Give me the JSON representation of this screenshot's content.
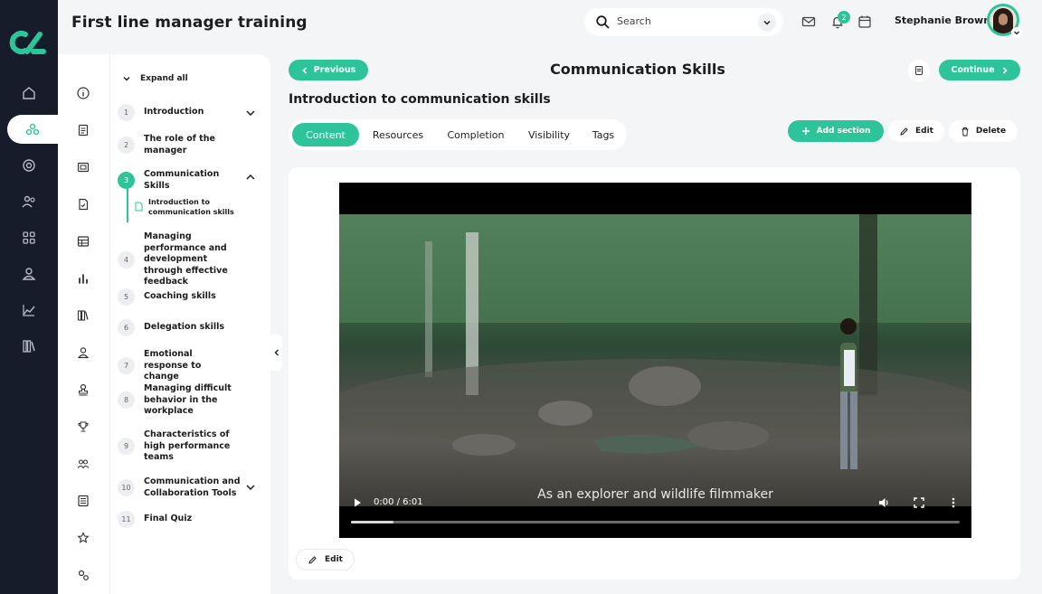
{
  "app": {
    "title": "First line manager training"
  },
  "search": {
    "placeholder": "Search"
  },
  "notifications": {
    "count": "2"
  },
  "user": {
    "name": "Stephanie Brown"
  },
  "nav": {
    "previous_label": "Previous",
    "continue_label": "Continue"
  },
  "page": {
    "title": "Communication Skills",
    "section_title": "Introduction to communication skills"
  },
  "tabs": [
    {
      "label": "Content",
      "active": true
    },
    {
      "label": "Resources",
      "active": false
    },
    {
      "label": "Completion",
      "active": false
    },
    {
      "label": "Visibility",
      "active": false
    },
    {
      "label": "Tags",
      "active": false
    }
  ],
  "actions": {
    "add_section": "Add section",
    "edit": "Edit",
    "delete": "Delete"
  },
  "outline": {
    "expand_all": "Expand all",
    "modules": [
      {
        "num": "1",
        "label": "Introduction"
      },
      {
        "num": "2",
        "label": "The role of the manager"
      },
      {
        "num": "3",
        "label": "Communication Skills"
      },
      {
        "num": "4",
        "label": "Managing performance and development through effective feedback"
      },
      {
        "num": "5",
        "label": "Coaching skills"
      },
      {
        "num": "6",
        "label": "Delegation skills"
      },
      {
        "num": "7",
        "label": "Emotional response to change"
      },
      {
        "num": "8",
        "label": "Managing difficult behavior in the workplace"
      },
      {
        "num": "9",
        "label": "Characteristics of high performance teams"
      },
      {
        "num": "10",
        "label": "Communication and Collaboration Tools"
      },
      {
        "num": "11",
        "label": "Final Quiz"
      }
    ],
    "sub_item": "Introduction to communication skills"
  },
  "video": {
    "time": "0:00 / 6:01",
    "caption": "As an explorer and wildlife filmmaker",
    "progress": 0.07
  },
  "card": {
    "edit_label": "Edit"
  },
  "colors": {
    "accent": "#2ec49a",
    "rail": "#161c2a",
    "background": "#f4f5f7"
  }
}
